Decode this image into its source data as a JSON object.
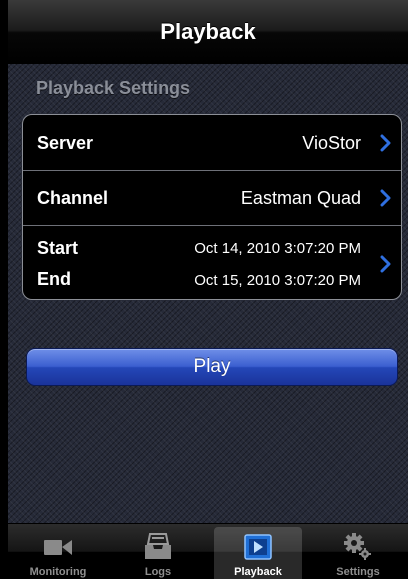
{
  "navbar": {
    "title": "Playback"
  },
  "settings": {
    "section_title": "Playback Settings",
    "server": {
      "label": "Server",
      "value": "VioStor"
    },
    "channel": {
      "label": "Channel",
      "value": "Eastman Quad"
    },
    "time": {
      "start_label": "Start",
      "start_value": "Oct 14, 2010 3:07:20 PM",
      "end_label": "End",
      "end_value": "Oct 15, 2010 3:07:20 PM"
    }
  },
  "play_button": {
    "label": "Play"
  },
  "tabbar": {
    "selected": "Playback",
    "tabs": [
      {
        "label": "Monitoring",
        "icon": "video-camera-icon"
      },
      {
        "label": "Logs",
        "icon": "inbox-tray-icon"
      },
      {
        "label": "Playback",
        "icon": "play-box-icon"
      },
      {
        "label": "Settings",
        "icon": "gears-icon"
      }
    ]
  },
  "colors": {
    "accent": "#2f6fe0",
    "play_button": "#3b5fd0",
    "background": "#262a38"
  }
}
